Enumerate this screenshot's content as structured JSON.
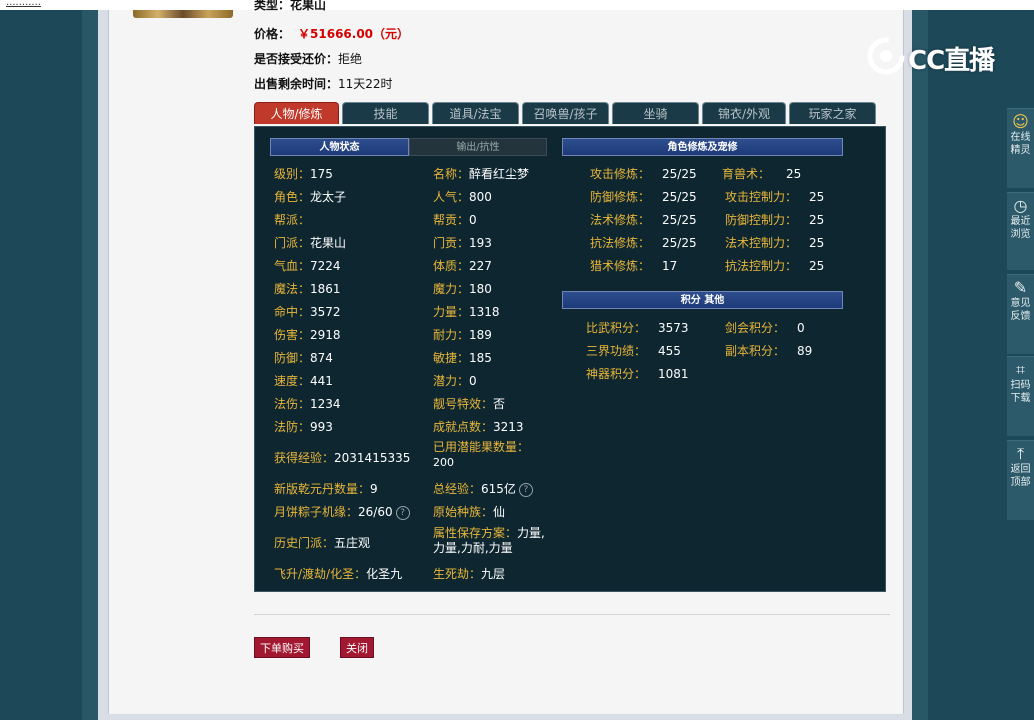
{
  "top": {
    "underline": "..........."
  },
  "listing": {
    "type_text": "类型：花果山",
    "price_label": "价格：",
    "price_value": "￥51666.00（元）",
    "bargain_label": "是否接受还价：",
    "bargain_value": "拒绝",
    "remain_label": "出售剩余时间：",
    "remain_value": "11天22时"
  },
  "tabs": [
    "人物/修炼",
    "技能",
    "道具/法宝",
    "召唤兽/孩子",
    "坐骑",
    "锦衣/外观",
    "玩家之家"
  ],
  "headers": {
    "status": "人物状态",
    "resist": "输出/抗性",
    "cultivation": "角色修炼及宠修",
    "points": "积分 其他"
  },
  "stats_left": [
    {
      "label": "级别：",
      "value": "175"
    },
    {
      "label": "角色：",
      "value": "龙太子"
    },
    {
      "label": "帮派：",
      "value": ""
    },
    {
      "label": "门派：",
      "value": "花果山"
    },
    {
      "label": "气血：",
      "value": "7224"
    },
    {
      "label": "魔法：",
      "value": "1861"
    },
    {
      "label": "命中：",
      "value": "3572"
    },
    {
      "label": "伤害：",
      "value": "2918"
    },
    {
      "label": "防御：",
      "value": "874"
    },
    {
      "label": "速度：",
      "value": "441"
    },
    {
      "label": "法伤：",
      "value": "1234"
    },
    {
      "label": "法防：",
      "value": "993"
    },
    {
      "label": "获得经验：",
      "value": "2031415335"
    },
    {
      "label": "新版乾元丹数量：",
      "value": "9"
    },
    {
      "label": "月饼粽子机缘：",
      "value": "26/60"
    },
    {
      "label": "历史门派：",
      "value": "五庄观"
    },
    {
      "label": "飞升/渡劫/化圣：",
      "value": "化圣九"
    }
  ],
  "stats_right": [
    {
      "label": "名称：",
      "value": "醉看红尘梦"
    },
    {
      "label": "人气：",
      "value": "800"
    },
    {
      "label": "帮贡：",
      "value": "0"
    },
    {
      "label": "门贡：",
      "value": "193"
    },
    {
      "label": "体质：",
      "value": "227"
    },
    {
      "label": "魔力：",
      "value": "180"
    },
    {
      "label": "力量：",
      "value": "1318"
    },
    {
      "label": "耐力：",
      "value": "189"
    },
    {
      "label": "敏捷：",
      "value": "185"
    },
    {
      "label": "潜力：",
      "value": "0"
    },
    {
      "label": "靓号特效：",
      "value": "否"
    },
    {
      "label": "成就点数：",
      "value": "3213"
    },
    {
      "label": "已用潜能果数量：",
      "value": "200"
    },
    {
      "label": "总经验：",
      "value": "615亿"
    },
    {
      "label": "原始种族：",
      "value": "仙"
    },
    {
      "label": "属性保存方案：",
      "value": "力量,力量,力耐,力量"
    },
    {
      "label": "生死劫：",
      "value": "九层"
    }
  ],
  "cultivation": [
    {
      "label": "攻击修炼：",
      "value": "25/25"
    },
    {
      "label": "防御修炼：",
      "value": "25/25"
    },
    {
      "label": "法术修炼：",
      "value": "25/25"
    },
    {
      "label": "抗法修炼：",
      "value": "25/25"
    },
    {
      "label": "猎术修炼：",
      "value": "17"
    }
  ],
  "pet_cultivation": [
    {
      "label": "育兽术：",
      "value": "25"
    },
    {
      "label": "攻击控制力：",
      "value": "25"
    },
    {
      "label": "防御控制力：",
      "value": "25"
    },
    {
      "label": "法术控制力：",
      "value": "25"
    },
    {
      "label": "抗法控制力：",
      "value": "25"
    }
  ],
  "points_left": [
    {
      "label": "比武积分：",
      "value": "3573"
    },
    {
      "label": "三界功绩：",
      "value": "455"
    },
    {
      "label": "神器积分：",
      "value": "1081"
    }
  ],
  "points_right": [
    {
      "label": "剑会积分：",
      "value": "0"
    },
    {
      "label": "副本积分：",
      "value": "89"
    }
  ],
  "buttons": {
    "buy": "下单购买",
    "close": "关闭"
  },
  "logo": {
    "text": "CC直播"
  },
  "sidebar": [
    {
      "label": "在线精灵",
      "icon": "sprite-icon"
    },
    {
      "label": "最近浏览",
      "icon": "clock-icon"
    },
    {
      "label": "意见反馈",
      "icon": "edit-icon"
    },
    {
      "label": "扫码下载",
      "icon": "scan-icon"
    },
    {
      "label": "返回顶部",
      "icon": "top-arrow-icon"
    }
  ],
  "help_glyph": "?"
}
